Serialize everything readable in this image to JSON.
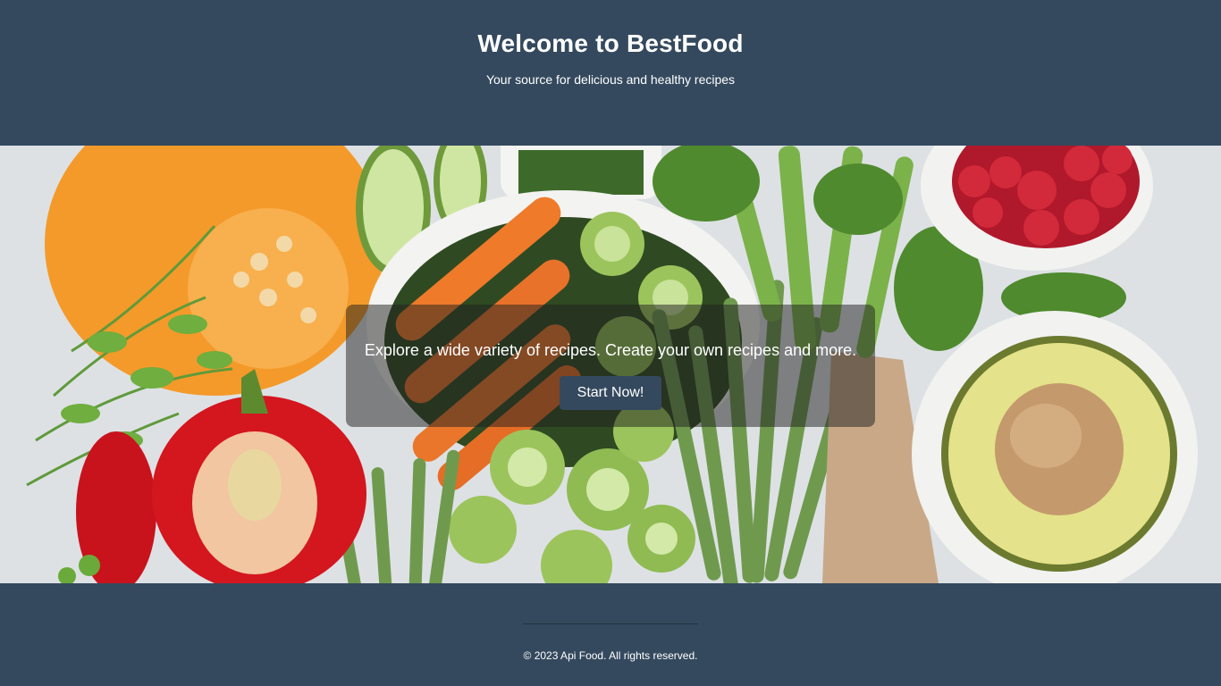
{
  "header": {
    "title": "Welcome to BestFood",
    "subtitle": "Your source for delicious and healthy recipes"
  },
  "hero": {
    "image": "vegetables-banner-image",
    "tagline": "Explore a wide variety of recipes. Create your own recipes and more.",
    "cta_label": "Start Now!"
  },
  "footer": {
    "copyright": "© 2023 Api Food. All rights reserved."
  },
  "colors": {
    "brand": "#34495e",
    "overlay": "rgba(30,30,30,0.5)"
  }
}
